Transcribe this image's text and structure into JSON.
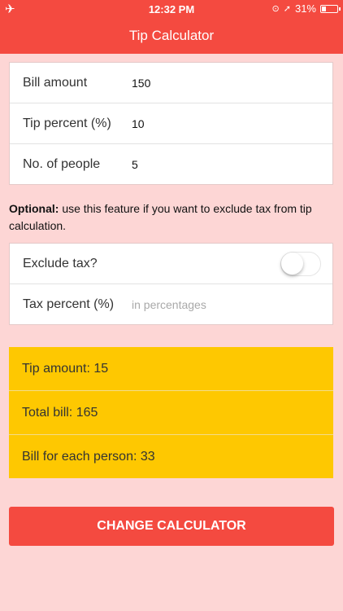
{
  "status_bar": {
    "time": "12:32 PM",
    "battery": "31%",
    "battery_level": 0.31
  },
  "navbar": {
    "title": "Tip Calculator"
  },
  "inputs": [
    {
      "label": "Bill amount",
      "value": "150"
    },
    {
      "label": "Tip percent (%)",
      "value": "10"
    },
    {
      "label": "No. of people",
      "value": "5"
    }
  ],
  "optional": {
    "bold": "Optional:",
    "text": " use this feature if you want to exclude tax from tip calculation."
  },
  "tax": {
    "exclude_label": "Exclude tax?",
    "exclude_on": false,
    "percent_label": "Tax percent (%)",
    "percent_placeholder": "in percentages"
  },
  "results": {
    "tip_amount": "Tip amount: 15",
    "total_bill": "Total bill: 165",
    "per_person": "Bill for each person: 33"
  },
  "button": {
    "label": "CHANGE CALCULATOR"
  },
  "colors": {
    "accent": "#f44a40",
    "background": "#fdd6d5",
    "results": "#fec801"
  }
}
